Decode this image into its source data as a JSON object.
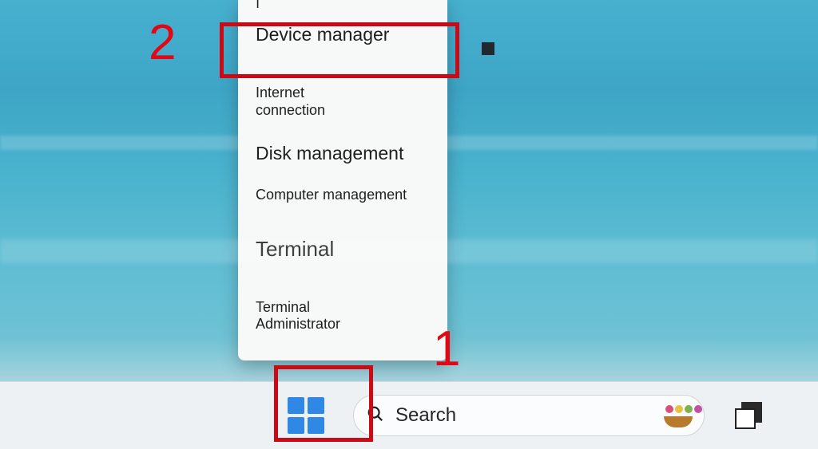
{
  "context_menu": {
    "cut_top": "|",
    "items": [
      {
        "label": "Device manager",
        "size": "large"
      },
      {
        "label": "Internet\nconnection",
        "size": "medium"
      },
      {
        "label": "Disk management",
        "size": "large"
      },
      {
        "label": "Computer management",
        "size": "medium"
      },
      {
        "label": "Terminal",
        "size": "small"
      },
      {
        "label": "Terminal\nAdministrator",
        "size": "medium"
      }
    ]
  },
  "taskbar": {
    "search_placeholder": "Search"
  },
  "annotations": {
    "n1": "1",
    "n2": "2"
  }
}
